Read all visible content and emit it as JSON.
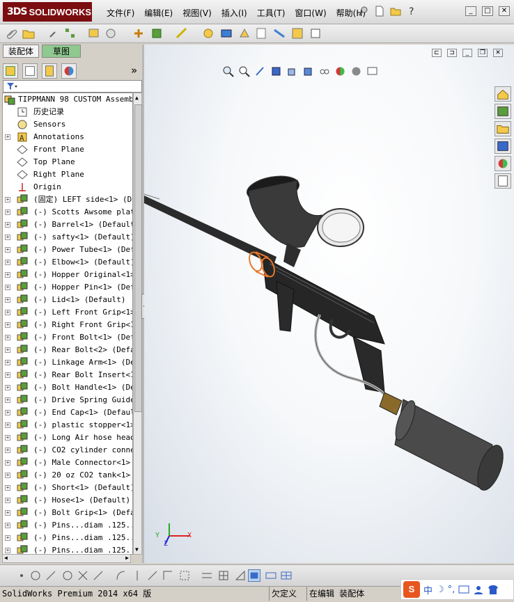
{
  "app": {
    "brand_prefix": "3DS",
    "brand_name": "SOLIDWORKS"
  },
  "menu": [
    "文件(F)",
    "编辑(E)",
    "视图(V)",
    "插入(I)",
    "工具(T)",
    "窗口(W)",
    "帮助(H)"
  ],
  "panel_tabs": {
    "assembly": "装配体",
    "sketch": "草图"
  },
  "more_glyph": "»",
  "tree": {
    "root": "TIPPMANN 98 CUSTOM Assembly",
    "items": [
      {
        "label": "历史记录",
        "icon": "history-icon",
        "exp": false
      },
      {
        "label": "Sensors",
        "icon": "sensor-icon",
        "exp": false
      },
      {
        "label": "Annotations",
        "icon": "annotation-icon",
        "exp": true
      },
      {
        "label": "Front Plane",
        "icon": "plane-icon",
        "exp": false
      },
      {
        "label": "Top Plane",
        "icon": "plane-icon",
        "exp": false
      },
      {
        "label": "Right Plane",
        "icon": "plane-icon",
        "exp": false
      },
      {
        "label": "Origin",
        "icon": "origin-icon",
        "exp": false
      },
      {
        "label": "(固定) LEFT side<1> (Def",
        "icon": "part-icon",
        "exp": true
      },
      {
        "label": "(-) Scotts Awsome plate<",
        "icon": "part-icon",
        "exp": true
      },
      {
        "label": "(-) Barrel<1> (Default)",
        "icon": "part-icon",
        "exp": true
      },
      {
        "label": "(-) safty<1> (Default)",
        "icon": "part-icon",
        "exp": true
      },
      {
        "label": "(-) Power Tube<1> (Defau",
        "icon": "part-icon",
        "exp": true
      },
      {
        "label": "(-) Elbow<1> (Default)",
        "icon": "part-icon",
        "exp": true
      },
      {
        "label": "(-) Hopper Original<1> (",
        "icon": "part-icon",
        "exp": true
      },
      {
        "label": "(-) Hopper Pin<1> (Defau",
        "icon": "part-icon",
        "exp": true
      },
      {
        "label": "(-) Lid<1> (Default)",
        "icon": "part-icon",
        "exp": true
      },
      {
        "label": "(-) Left Front Grip<1> (",
        "icon": "part-icon",
        "exp": true
      },
      {
        "label": "(-) Right Front Grip<1>",
        "icon": "part-icon",
        "exp": true
      },
      {
        "label": "(-) Front Bolt<1> (Defau",
        "icon": "part-icon",
        "exp": true
      },
      {
        "label": "(-) Rear Bolt<2> (Defaul",
        "icon": "part-icon",
        "exp": true
      },
      {
        "label": "(-) Linkage Arm<1> (Defa",
        "icon": "part-icon",
        "exp": true
      },
      {
        "label": "(-) Rear Bolt Insert<1>",
        "icon": "part-icon",
        "exp": true
      },
      {
        "label": "(-) Bolt Handle<1> (Defa",
        "icon": "part-icon",
        "exp": true
      },
      {
        "label": "(-) Drive Spring Guide P",
        "icon": "part-icon",
        "exp": true
      },
      {
        "label": "(-) End Cap<1> (Default)",
        "icon": "part-icon",
        "exp": true
      },
      {
        "label": "(-) plastic stopper<1> (",
        "icon": "part-icon",
        "exp": true
      },
      {
        "label": "(-) Long Air hose head<1",
        "icon": "part-icon",
        "exp": true
      },
      {
        "label": "(-) CO2 cylinder connect",
        "icon": "part-icon",
        "exp": true
      },
      {
        "label": "(-) Male Connector<1> (D",
        "icon": "part-icon",
        "exp": true
      },
      {
        "label": "(-) 20 oz CO2 tank<1> (D",
        "icon": "part-icon",
        "exp": true
      },
      {
        "label": "(-) Short<1> (Default)",
        "icon": "part-icon",
        "exp": true
      },
      {
        "label": "(-) Hose<1> (Default)",
        "icon": "part-icon",
        "exp": true
      },
      {
        "label": "(-) Bolt Grip<1> (Defaul",
        "icon": "part-icon",
        "exp": true
      },
      {
        "label": "(-) Pins...diam .125....",
        "icon": "part-icon",
        "exp": true
      },
      {
        "label": "(-) Pins...diam .125....",
        "icon": "part-icon",
        "exp": true
      },
      {
        "label": "(-) Pins...diam .125....",
        "icon": "part-icon",
        "exp": true
      }
    ]
  },
  "triad": {
    "x": "X",
    "y": "Y",
    "z": "Z"
  },
  "status": {
    "product": "SolidWorks Premium 2014 x64 版",
    "definition": "欠定义",
    "mode": "在编辑 装配体"
  },
  "ime": {
    "lang": "中",
    "moon": "☽",
    "dot": "°,"
  },
  "colors": {
    "brand": "#7a0d10",
    "selection_orange": "#e8782a",
    "viewport_bg": "#f6f8fa"
  }
}
